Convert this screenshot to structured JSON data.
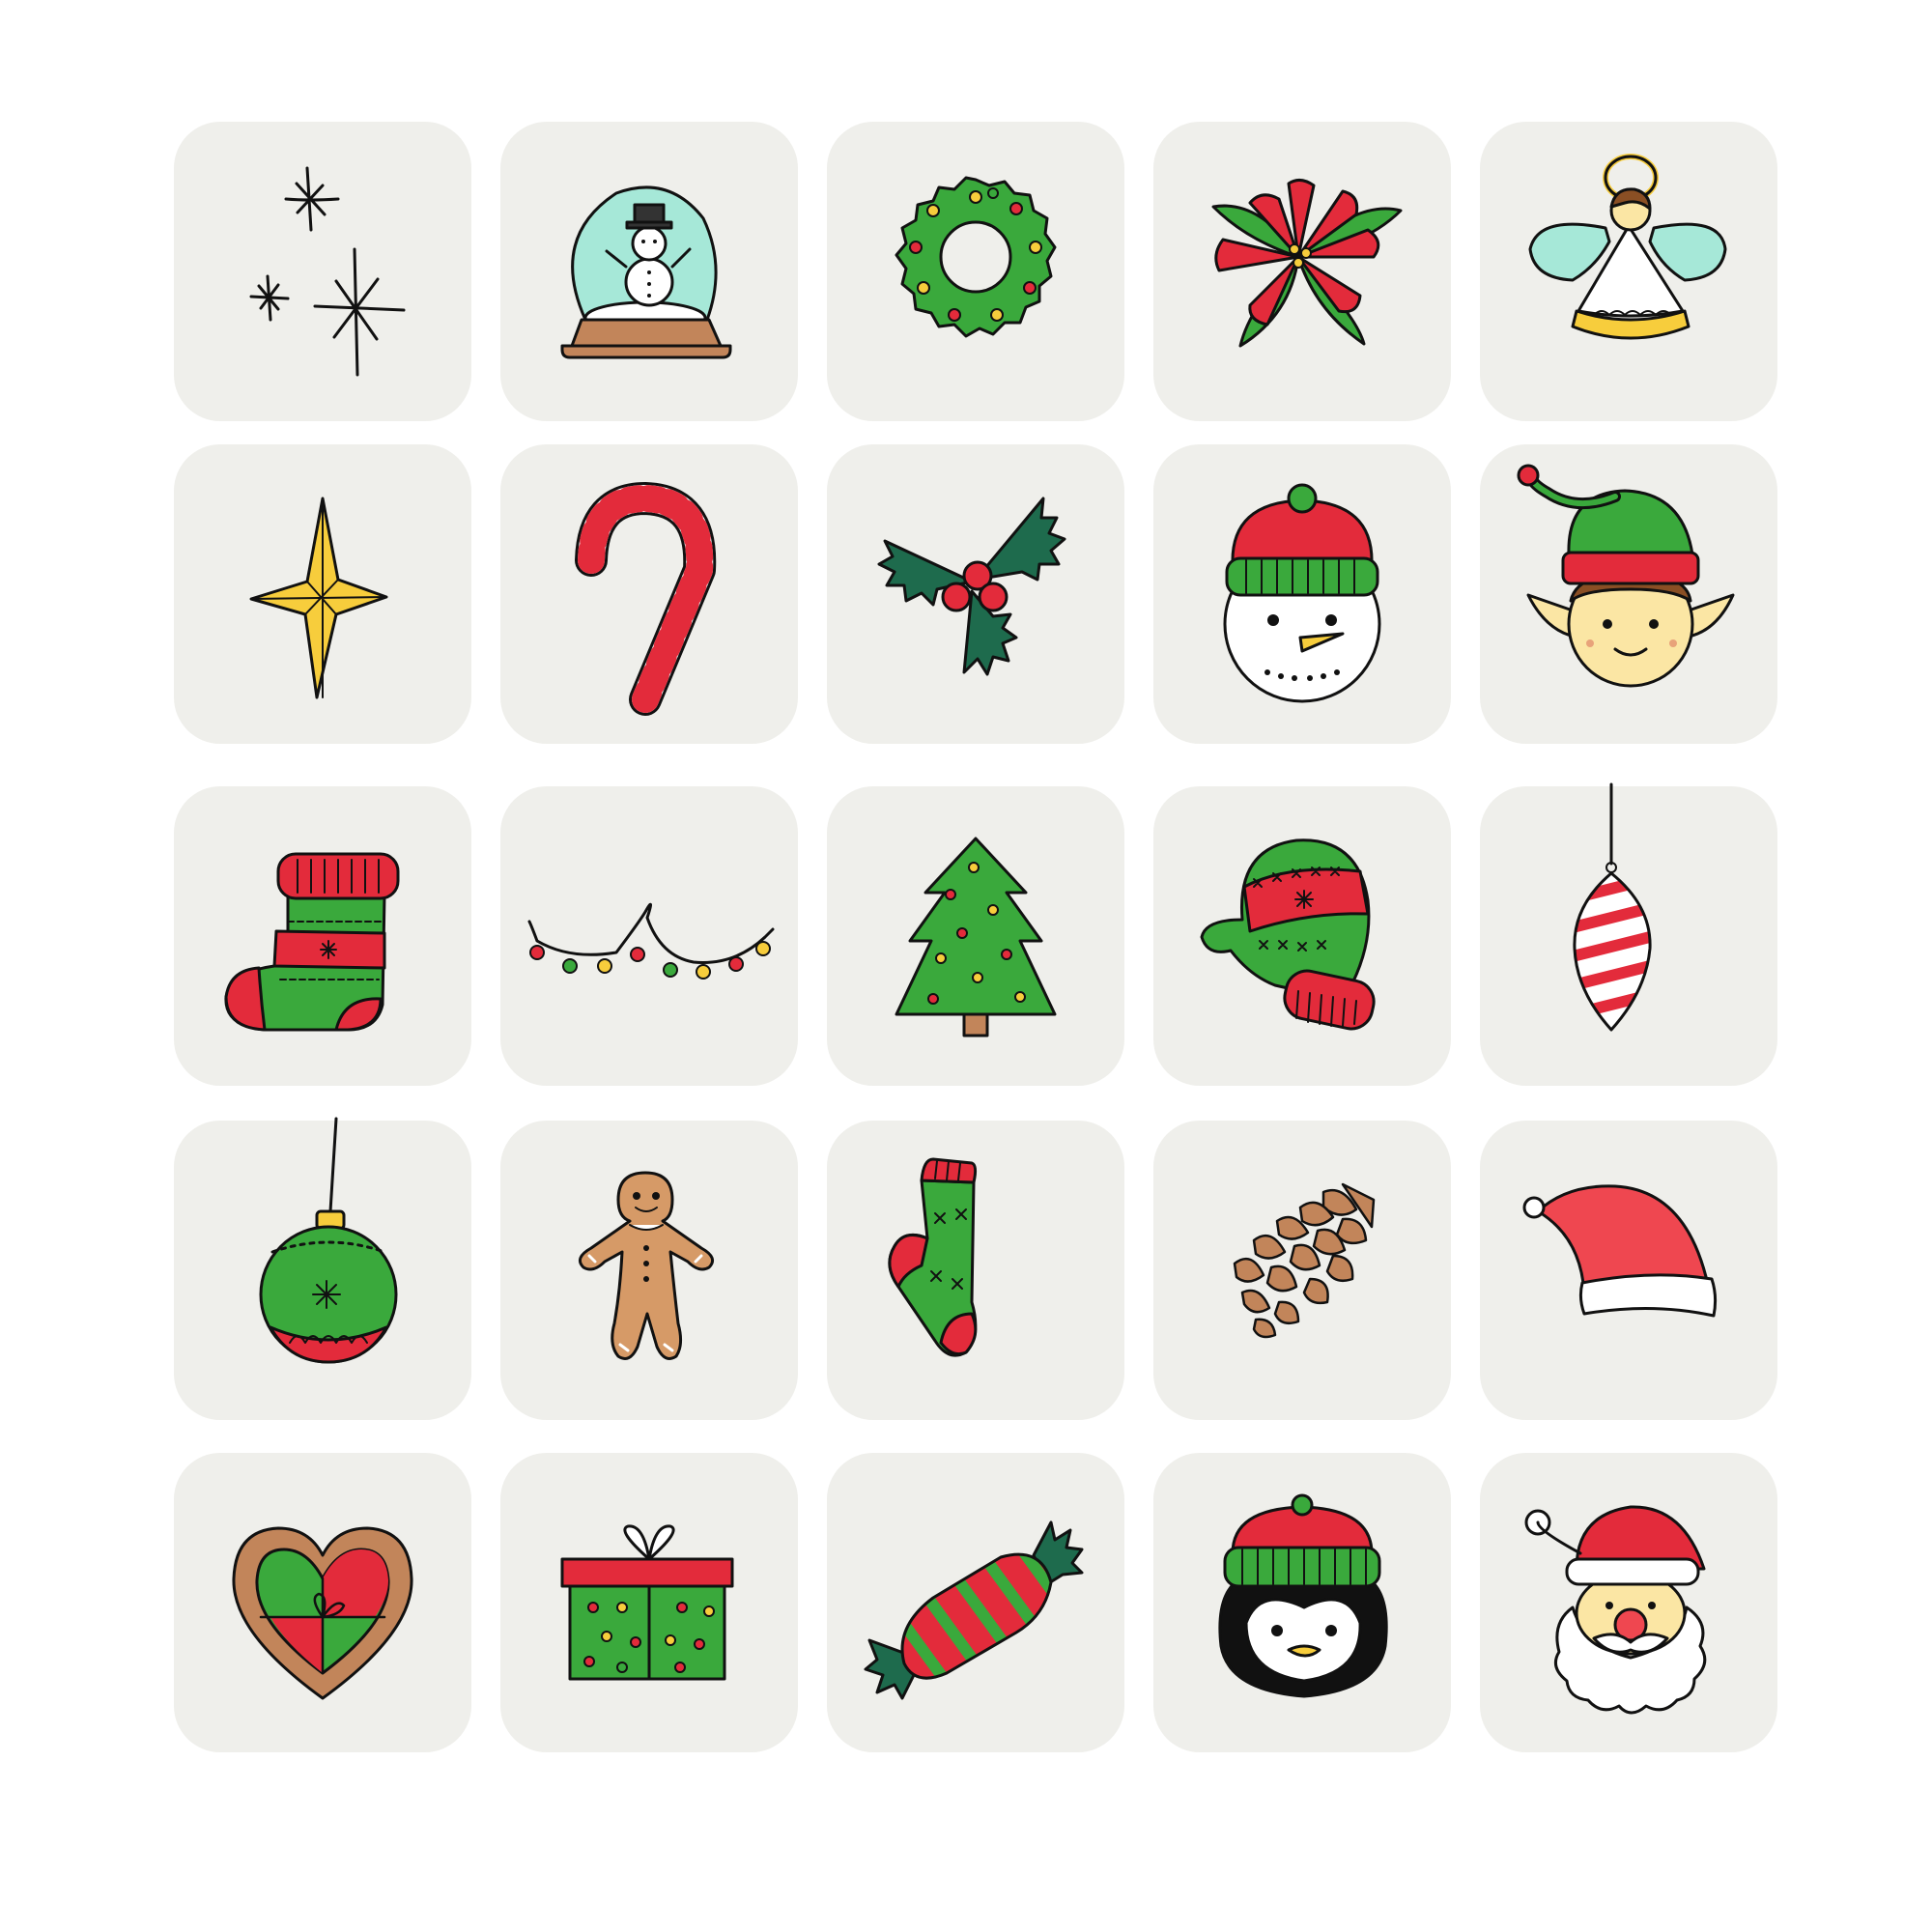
{
  "palette": {
    "tile_bg": "#efefeb",
    "red": "#e32b3b",
    "green": "#3aa93c",
    "dark_green": "#1e6b4d",
    "yellow": "#f7cd3c",
    "mint": "#a6e8d8",
    "brown": "#c2855a",
    "skin": "#fbe6a4",
    "outline": "#111111"
  },
  "icons": [
    {
      "name": "sparkles-icon"
    },
    {
      "name": "snow-globe-icon"
    },
    {
      "name": "wreath-icon"
    },
    {
      "name": "poinsettia-icon"
    },
    {
      "name": "angel-icon"
    },
    {
      "name": "star-icon"
    },
    {
      "name": "candy-cane-icon"
    },
    {
      "name": "holly-icon"
    },
    {
      "name": "snowman-face-icon"
    },
    {
      "name": "elf-face-icon"
    },
    {
      "name": "stocking-icon"
    },
    {
      "name": "string-lights-icon"
    },
    {
      "name": "christmas-tree-icon"
    },
    {
      "name": "mitten-icon"
    },
    {
      "name": "striped-ornament-icon"
    },
    {
      "name": "bauble-ornament-icon"
    },
    {
      "name": "gingerbread-man-icon"
    },
    {
      "name": "sock-icon"
    },
    {
      "name": "pine-cone-icon"
    },
    {
      "name": "santa-hat-icon"
    },
    {
      "name": "gingerbread-heart-icon"
    },
    {
      "name": "gift-box-icon"
    },
    {
      "name": "wrapped-candy-icon"
    },
    {
      "name": "penguin-face-icon"
    },
    {
      "name": "santa-face-icon"
    }
  ]
}
